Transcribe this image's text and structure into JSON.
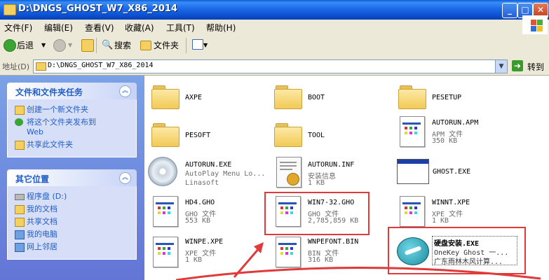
{
  "window": {
    "title": "D:\\DNGS_GHOST_W7_X86_2014",
    "min": "_",
    "max": "□",
    "close": "✕"
  },
  "menu": [
    "文件(F)",
    "编辑(E)",
    "查看(V)",
    "收藏(A)",
    "工具(T)",
    "帮助(H)"
  ],
  "toolbar": {
    "back": "后退",
    "search": "搜索",
    "folders": "文件夹"
  },
  "address": {
    "label": "地址(D)",
    "value": "D:\\DNGS_GHOST_W7_X86_2014",
    "go": "转到"
  },
  "tasks_panel": {
    "title": "文件和文件夹任务",
    "items": [
      "创建一个新文件夹",
      "将这个文件夹发布到",
      "Web",
      "共享此文件夹"
    ]
  },
  "places_panel": {
    "title": "其它位置",
    "items": [
      "程序盘 (D:)",
      "我的文档",
      "共享文档",
      "我的电脑",
      "网上邻居"
    ]
  },
  "files": [
    {
      "name": "AXPE",
      "type": "folder"
    },
    {
      "name": "BOOT",
      "type": "folder"
    },
    {
      "name": "PESETUP",
      "type": "folder"
    },
    {
      "name": "PESOFT",
      "type": "folder"
    },
    {
      "name": "TOOL",
      "type": "folder"
    },
    {
      "name": "AUTORUN.APM",
      "line2": "APM 文件",
      "line3": "350 KB",
      "type": "doc"
    },
    {
      "name": "AUTORUN.EXE",
      "line2": "AutoPlay Menu Lo...",
      "line3": "Linasoft",
      "type": "cd"
    },
    {
      "name": "AUTORUN.INF",
      "line2": "安装信息",
      "line3": "1 KB",
      "type": "inf"
    },
    {
      "name": "GHOST.EXE",
      "type": "exe"
    },
    {
      "name": "HD4.GHO",
      "line2": "GHO 文件",
      "line3": "553 KB",
      "type": "doc"
    },
    {
      "name": "WIN7-32.GHO",
      "line2": "GHO 文件",
      "line3": "2,785,859 KB",
      "type": "doc"
    },
    {
      "name": "WINNT.XPE",
      "line2": "XPE 文件",
      "line3": "1 KB",
      "type": "doc"
    },
    {
      "name": "WINPE.XPE",
      "line2": "XPE 文件",
      "line3": "1 KB",
      "type": "doc"
    },
    {
      "name": "WNPEFONT.BIN",
      "line2": "BIN 文件",
      "line3": "316 KB",
      "type": "doc"
    },
    {
      "name": "硬盘安装.EXE",
      "line2": "OneKey Ghost 一...",
      "line3": "广东雨林木风计算...",
      "type": "onekey"
    }
  ]
}
